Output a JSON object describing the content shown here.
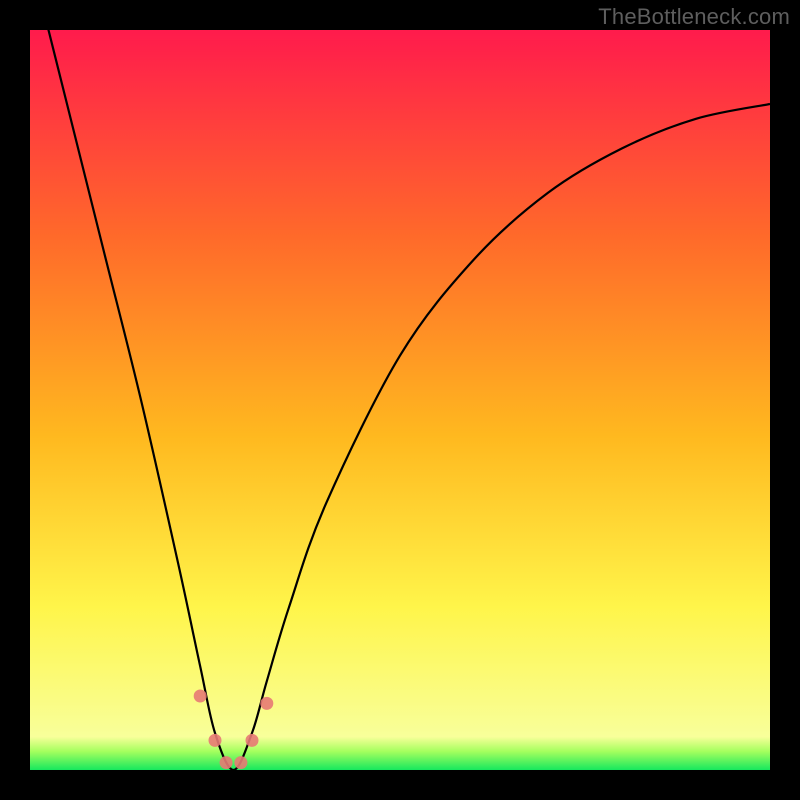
{
  "watermark": "TheBottleneck.com",
  "chart_data": {
    "type": "line",
    "title": "",
    "xlabel": "",
    "ylabel": "",
    "xlim": [
      0,
      100
    ],
    "ylim": [
      0,
      100
    ],
    "notch_x": 27.5,
    "series": [
      {
        "name": "bottleneck-curve",
        "x": [
          0,
          5,
          10,
          15,
          20,
          23,
          25,
          27.5,
          30,
          32,
          35,
          40,
          50,
          60,
          70,
          80,
          90,
          100
        ],
        "values": [
          110,
          90,
          70,
          50,
          28,
          14,
          5,
          0,
          5,
          12,
          22,
          36,
          56,
          69,
          78,
          84,
          88,
          90
        ]
      }
    ],
    "markers": {
      "name": "notch-markers",
      "x": [
        23,
        25,
        26.5,
        28.5,
        30,
        32
      ],
      "values": [
        10,
        4,
        1,
        1,
        4,
        9
      ]
    },
    "gradient_stops": [
      {
        "offset": 0,
        "color": "#ff1b4c"
      },
      {
        "offset": 0.28,
        "color": "#ff6a2a"
      },
      {
        "offset": 0.55,
        "color": "#ffb91f"
      },
      {
        "offset": 0.78,
        "color": "#fff54a"
      },
      {
        "offset": 0.955,
        "color": "#f8ff9a"
      },
      {
        "offset": 0.975,
        "color": "#a4ff5e"
      },
      {
        "offset": 1.0,
        "color": "#16e85e"
      }
    ]
  }
}
